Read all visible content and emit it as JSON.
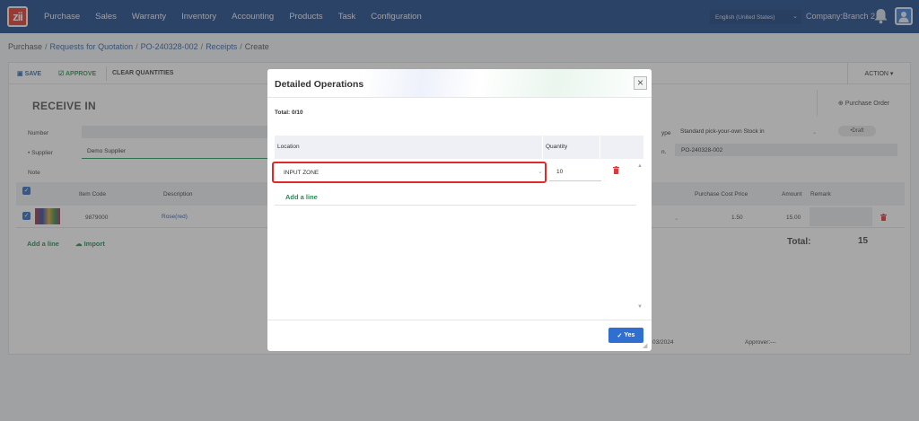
{
  "nav": {
    "logo": "zii",
    "menu": [
      "Purchase",
      "Sales",
      "Warranty",
      "Inventory",
      "Accounting",
      "Products",
      "Task",
      "Configuration"
    ],
    "language": "English (United States)",
    "company": "Company:Branch 2"
  },
  "breadcrumb": {
    "items": [
      "Purchase",
      "Requests for Quotation",
      "PO-240328-002",
      "Receipts",
      "Create"
    ]
  },
  "toolbar": {
    "save": "SAVE",
    "approve": "APPROVE",
    "clear": "CLEAR QUANTITIES",
    "action": "ACTION"
  },
  "form": {
    "title": "RECEIVE IN",
    "purchase_order_button": "Purchase Order",
    "number_label": "Number",
    "supplier_label": "Supplier",
    "supplier_value": "Demo Supplier",
    "note_label": "Note",
    "type_label_partial": "ype",
    "type_value": "Standard pick-your-own Stock in",
    "status": "Draft",
    "source_label_partial": "n.",
    "source_value": "PO-240328-002"
  },
  "lines": {
    "headers": {
      "item_code": "Item Code",
      "description": "Description",
      "purchase_cost_price": "Purchase Cost Price",
      "amount": "Amount",
      "remark": "Remark"
    },
    "rows": [
      {
        "item_code": "9879000",
        "description": "Rose(red)",
        "purchase_cost_price": "1.50",
        "amount": "15.00"
      }
    ],
    "add_line": "Add a line",
    "import": "Import",
    "total_label": "Total:",
    "total_value": "15",
    "date_partial": "03/2024",
    "approver": "Approver:---"
  },
  "modal": {
    "title": "Detailed Operations",
    "total": "Total: 0/10",
    "headers": {
      "location": "Location",
      "quantity": "Quantity"
    },
    "rows": [
      {
        "location": "INPUT ZONE",
        "quantity": "10"
      }
    ],
    "add_line": "Add a line",
    "yes_button": "Yes"
  },
  "colors": {
    "nav_bg": "#1f4a8c",
    "accent_blue": "#2f6fd0",
    "accent_green": "#2a8a58",
    "highlight_red": "#e02a2a",
    "trash_red": "#e0383a"
  }
}
